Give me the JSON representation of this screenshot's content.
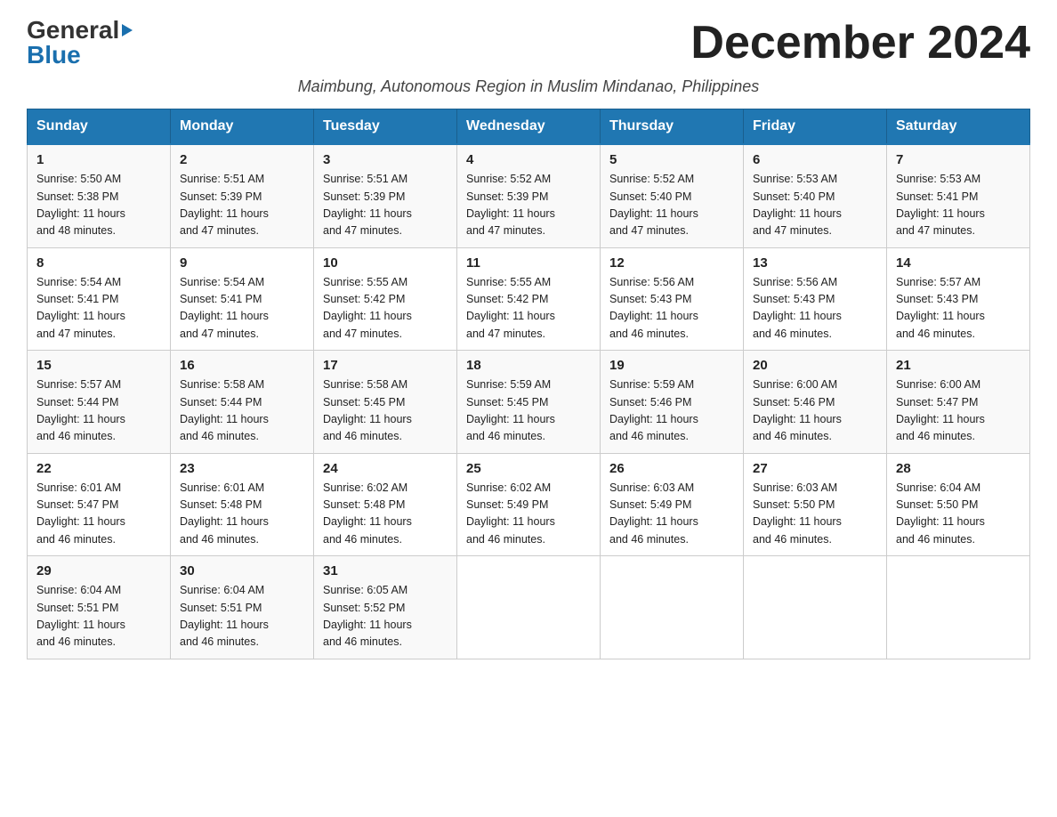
{
  "logo": {
    "general": "General",
    "blue": "Blue",
    "arrow": "▶"
  },
  "title": "December 2024",
  "subtitle": "Maimbung, Autonomous Region in Muslim Mindanao, Philippines",
  "days_of_week": [
    "Sunday",
    "Monday",
    "Tuesday",
    "Wednesday",
    "Thursday",
    "Friday",
    "Saturday"
  ],
  "weeks": [
    [
      {
        "day": "1",
        "sunrise": "5:50 AM",
        "sunset": "5:38 PM",
        "daylight": "11 hours and 48 minutes."
      },
      {
        "day": "2",
        "sunrise": "5:51 AM",
        "sunset": "5:39 PM",
        "daylight": "11 hours and 47 minutes."
      },
      {
        "day": "3",
        "sunrise": "5:51 AM",
        "sunset": "5:39 PM",
        "daylight": "11 hours and 47 minutes."
      },
      {
        "day": "4",
        "sunrise": "5:52 AM",
        "sunset": "5:39 PM",
        "daylight": "11 hours and 47 minutes."
      },
      {
        "day": "5",
        "sunrise": "5:52 AM",
        "sunset": "5:40 PM",
        "daylight": "11 hours and 47 minutes."
      },
      {
        "day": "6",
        "sunrise": "5:53 AM",
        "sunset": "5:40 PM",
        "daylight": "11 hours and 47 minutes."
      },
      {
        "day": "7",
        "sunrise": "5:53 AM",
        "sunset": "5:41 PM",
        "daylight": "11 hours and 47 minutes."
      }
    ],
    [
      {
        "day": "8",
        "sunrise": "5:54 AM",
        "sunset": "5:41 PM",
        "daylight": "11 hours and 47 minutes."
      },
      {
        "day": "9",
        "sunrise": "5:54 AM",
        "sunset": "5:41 PM",
        "daylight": "11 hours and 47 minutes."
      },
      {
        "day": "10",
        "sunrise": "5:55 AM",
        "sunset": "5:42 PM",
        "daylight": "11 hours and 47 minutes."
      },
      {
        "day": "11",
        "sunrise": "5:55 AM",
        "sunset": "5:42 PM",
        "daylight": "11 hours and 47 minutes."
      },
      {
        "day": "12",
        "sunrise": "5:56 AM",
        "sunset": "5:43 PM",
        "daylight": "11 hours and 46 minutes."
      },
      {
        "day": "13",
        "sunrise": "5:56 AM",
        "sunset": "5:43 PM",
        "daylight": "11 hours and 46 minutes."
      },
      {
        "day": "14",
        "sunrise": "5:57 AM",
        "sunset": "5:43 PM",
        "daylight": "11 hours and 46 minutes."
      }
    ],
    [
      {
        "day": "15",
        "sunrise": "5:57 AM",
        "sunset": "5:44 PM",
        "daylight": "11 hours and 46 minutes."
      },
      {
        "day": "16",
        "sunrise": "5:58 AM",
        "sunset": "5:44 PM",
        "daylight": "11 hours and 46 minutes."
      },
      {
        "day": "17",
        "sunrise": "5:58 AM",
        "sunset": "5:45 PM",
        "daylight": "11 hours and 46 minutes."
      },
      {
        "day": "18",
        "sunrise": "5:59 AM",
        "sunset": "5:45 PM",
        "daylight": "11 hours and 46 minutes."
      },
      {
        "day": "19",
        "sunrise": "5:59 AM",
        "sunset": "5:46 PM",
        "daylight": "11 hours and 46 minutes."
      },
      {
        "day": "20",
        "sunrise": "6:00 AM",
        "sunset": "5:46 PM",
        "daylight": "11 hours and 46 minutes."
      },
      {
        "day": "21",
        "sunrise": "6:00 AM",
        "sunset": "5:47 PM",
        "daylight": "11 hours and 46 minutes."
      }
    ],
    [
      {
        "day": "22",
        "sunrise": "6:01 AM",
        "sunset": "5:47 PM",
        "daylight": "11 hours and 46 minutes."
      },
      {
        "day": "23",
        "sunrise": "6:01 AM",
        "sunset": "5:48 PM",
        "daylight": "11 hours and 46 minutes."
      },
      {
        "day": "24",
        "sunrise": "6:02 AM",
        "sunset": "5:48 PM",
        "daylight": "11 hours and 46 minutes."
      },
      {
        "day": "25",
        "sunrise": "6:02 AM",
        "sunset": "5:49 PM",
        "daylight": "11 hours and 46 minutes."
      },
      {
        "day": "26",
        "sunrise": "6:03 AM",
        "sunset": "5:49 PM",
        "daylight": "11 hours and 46 minutes."
      },
      {
        "day": "27",
        "sunrise": "6:03 AM",
        "sunset": "5:50 PM",
        "daylight": "11 hours and 46 minutes."
      },
      {
        "day": "28",
        "sunrise": "6:04 AM",
        "sunset": "5:50 PM",
        "daylight": "11 hours and 46 minutes."
      }
    ],
    [
      {
        "day": "29",
        "sunrise": "6:04 AM",
        "sunset": "5:51 PM",
        "daylight": "11 hours and 46 minutes."
      },
      {
        "day": "30",
        "sunrise": "6:04 AM",
        "sunset": "5:51 PM",
        "daylight": "11 hours and 46 minutes."
      },
      {
        "day": "31",
        "sunrise": "6:05 AM",
        "sunset": "5:52 PM",
        "daylight": "11 hours and 46 minutes."
      },
      null,
      null,
      null,
      null
    ]
  ],
  "labels": {
    "sunrise": "Sunrise:",
    "sunset": "Sunset:",
    "daylight": "Daylight:"
  }
}
